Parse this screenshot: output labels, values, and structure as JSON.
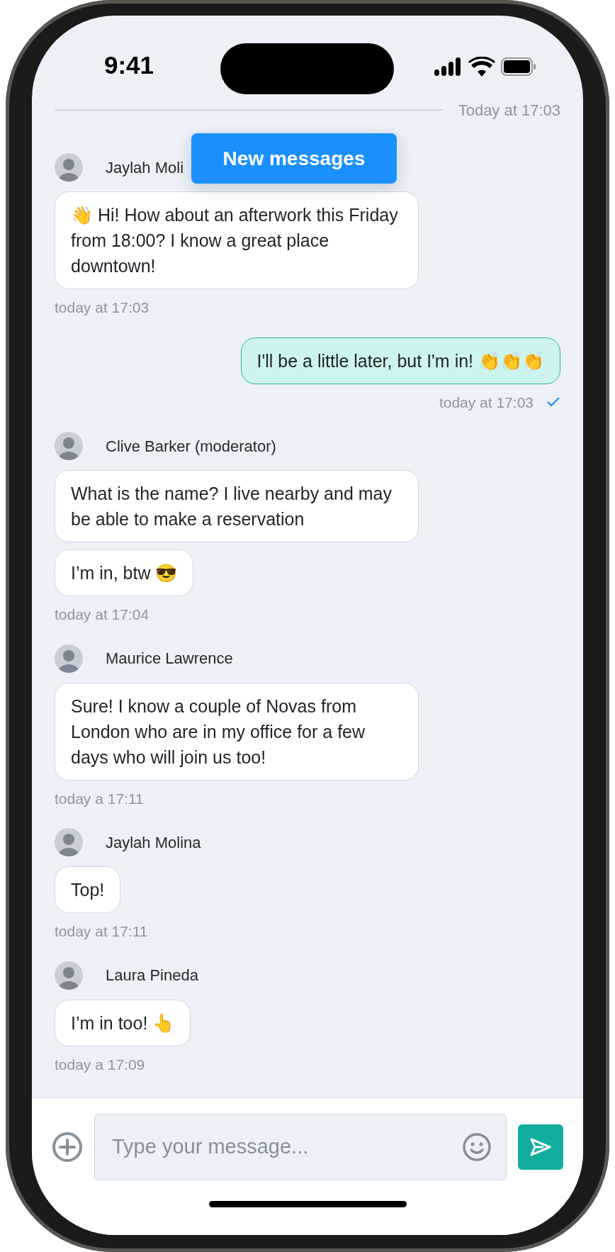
{
  "status_bar": {
    "time": "9:41"
  },
  "divider_label": "Today at 17:03",
  "new_messages_button": "New messages",
  "messages": [
    {
      "kind": "incoming",
      "sender": "Jaylah Moli",
      "bubbles": [
        "👋 Hi! How about an afterwork this Friday from 18:00? I know a great place downtown!"
      ],
      "time": "today at 17:03"
    },
    {
      "kind": "outgoing",
      "bubbles": [
        "I'll be a little later, but I'm in! 👏👏👏"
      ],
      "time": "today at 17:03",
      "read": true
    },
    {
      "kind": "incoming",
      "sender": "Clive Barker (moderator)",
      "bubbles": [
        "What is the name? I live nearby and may be able to make a reservation",
        "I’m in, btw 😎"
      ],
      "time": "today at 17:04"
    },
    {
      "kind": "incoming",
      "sender": "Maurice Lawrence",
      "bubbles": [
        "Sure! I know a couple of Novas from London who are in my office for a few days who will join us too!"
      ],
      "time": "today a 17:11"
    },
    {
      "kind": "incoming",
      "sender": "Jaylah Molina",
      "bubbles": [
        "Top!"
      ],
      "time": "today at 17:11"
    },
    {
      "kind": "incoming",
      "sender": "Laura Pineda",
      "bubbles": [
        "I’m in too! 👆"
      ],
      "time": "today a 17:09"
    }
  ],
  "composer": {
    "placeholder": "Type your message..."
  }
}
